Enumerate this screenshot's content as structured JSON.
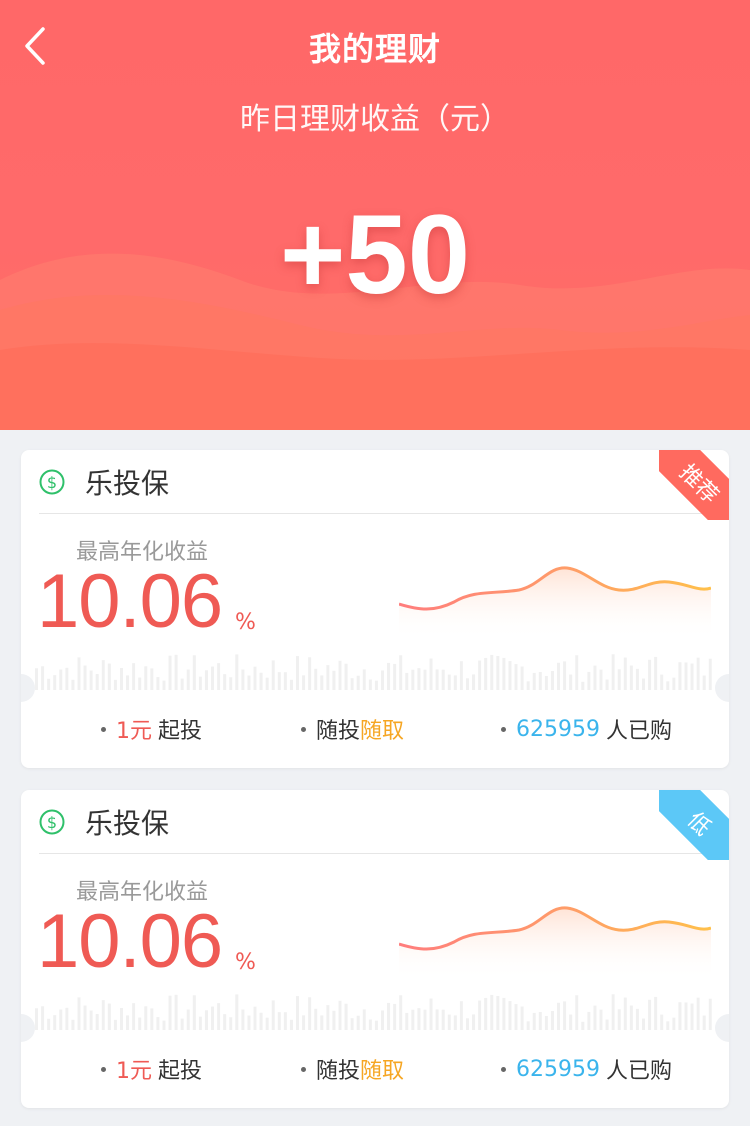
{
  "header": {
    "title": "我的理财",
    "subtitle": "昨日理财收益（元）",
    "amount": "+50"
  },
  "colors": {
    "header": "#ff6868",
    "accent_red": "#ef5a54",
    "accent_orange": "#f6a623",
    "accent_blue": "#3ab4ec",
    "ribbon_recommend": "#ff6a5f",
    "ribbon_low": "#5cc8f7",
    "coin_green": "#2fc06a"
  },
  "products": [
    {
      "name": "乐投保",
      "icon": "dollar-coin-icon",
      "badge": "推荐",
      "badge_color": "#ff6a5f",
      "rate_label": "最高年化收益",
      "rate": "10.06",
      "rate_unit": "%",
      "min_amount": "1元",
      "min_text": "起投",
      "flex_a": "随投",
      "flex_b": "随取",
      "buyers": "625959",
      "buyers_text": "人已购"
    },
    {
      "name": "乐投保",
      "icon": "dollar-coin-icon",
      "badge": "低",
      "badge_color": "#5cc8f7",
      "rate_label": "最高年化收益",
      "rate": "10.06",
      "rate_unit": "%",
      "min_amount": "1元",
      "min_text": "起投",
      "flex_a": "随投",
      "flex_b": "随取",
      "buyers": "625959",
      "buyers_text": "人已购"
    }
  ]
}
